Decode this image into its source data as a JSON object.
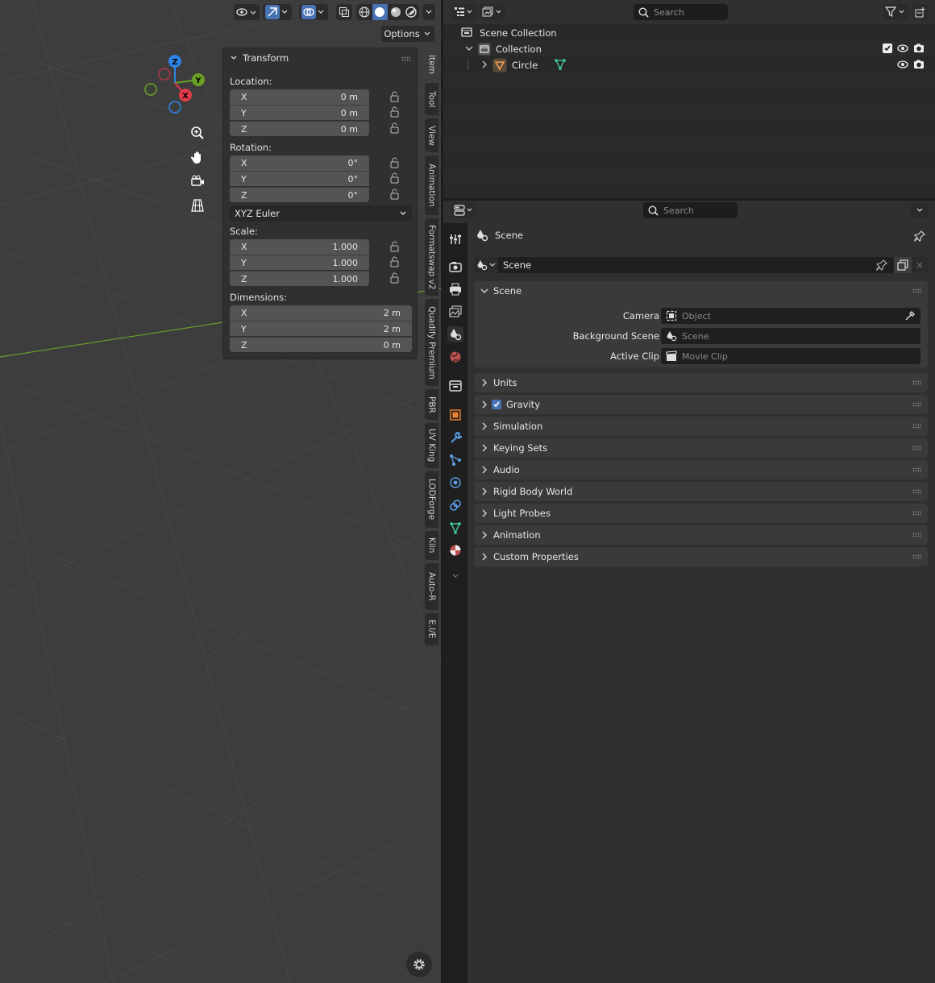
{
  "viewport": {
    "options_label": "Options",
    "gizmo": {
      "x": "X",
      "y": "Y",
      "z": "Z"
    }
  },
  "npanel": {
    "title": "Transform",
    "location_label": "Location:",
    "location": [
      {
        "axis": "X",
        "value": "0 m"
      },
      {
        "axis": "Y",
        "value": "0 m"
      },
      {
        "axis": "Z",
        "value": "0 m"
      }
    ],
    "rotation_label": "Rotation:",
    "rotation": [
      {
        "axis": "X",
        "value": "0°"
      },
      {
        "axis": "Y",
        "value": "0°"
      },
      {
        "axis": "Z",
        "value": "0°"
      }
    ],
    "rotation_mode": "XYZ Euler",
    "scale_label": "Scale:",
    "scale": [
      {
        "axis": "X",
        "value": "1.000"
      },
      {
        "axis": "Y",
        "value": "1.000"
      },
      {
        "axis": "Z",
        "value": "1.000"
      }
    ],
    "dimensions_label": "Dimensions:",
    "dimensions": [
      {
        "axis": "X",
        "value": "2 m"
      },
      {
        "axis": "Y",
        "value": "2 m"
      },
      {
        "axis": "Z",
        "value": "0 m"
      }
    ]
  },
  "sidebar_tabs": [
    "Item",
    "Tool",
    "View",
    "Animation",
    "Formatswap v2",
    "Quadify Premium",
    "PBR",
    "UV King",
    "LODForge",
    "Kiln",
    "Auto-R",
    "E.I/E"
  ],
  "outliner": {
    "search_placeholder": "Search",
    "scene_collection": "Scene Collection",
    "collection": "Collection",
    "object": "Circle"
  },
  "properties": {
    "search_placeholder": "Search",
    "context_title": "Scene",
    "datablock_name": "Scene",
    "scene_panel": {
      "title": "Scene",
      "camera_label": "Camera",
      "camera_placeholder": "Object",
      "background_label": "Background Scene",
      "background_placeholder": "Scene",
      "clip_label": "Active Clip",
      "clip_placeholder": "Movie Clip"
    },
    "panels": [
      "Units",
      "Gravity",
      "Simulation",
      "Keying Sets",
      "Audio",
      "Rigid Body World",
      "Light Probes",
      "Animation",
      "Custom Properties"
    ],
    "gravity_enabled": true
  },
  "colors": {
    "accent": "#4772b3",
    "axis_x": "#e23a4a",
    "axis_y": "#6aa124",
    "axis_z": "#2f83e6",
    "mesh_data": "#3fd1a0"
  }
}
